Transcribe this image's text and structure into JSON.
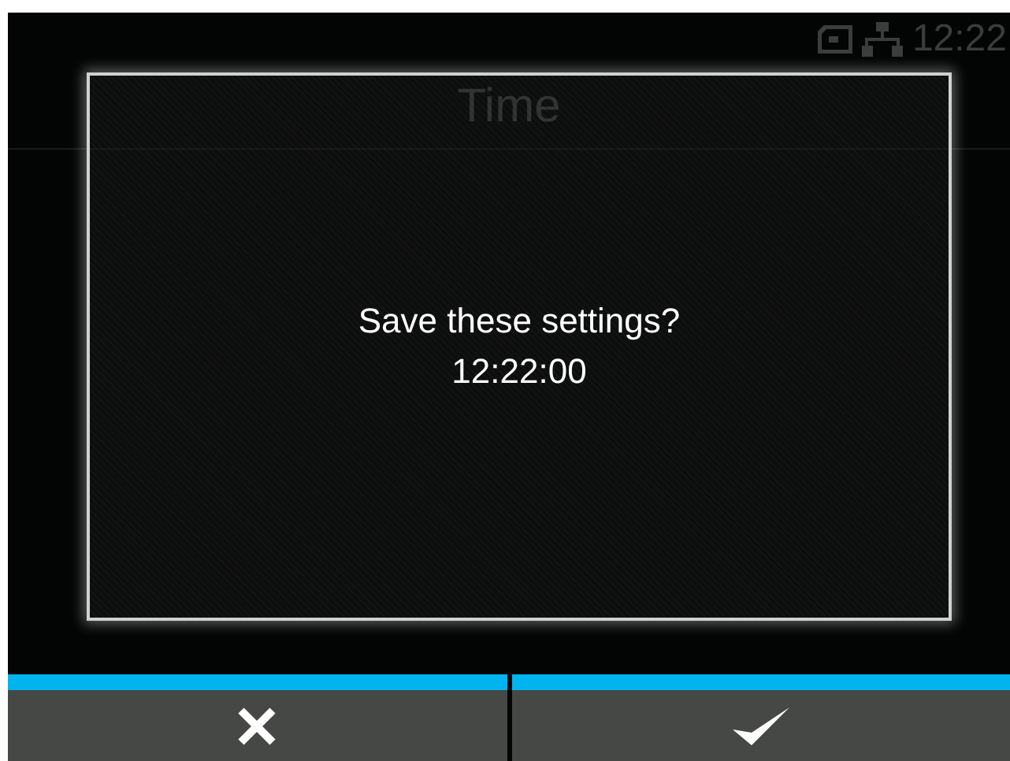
{
  "status_bar": {
    "time": "12:22"
  },
  "screen": {
    "title": "Time"
  },
  "dialog": {
    "message": "Save these settings?",
    "value": "12:22:00"
  },
  "buttons": [
    {
      "kind": "cancel"
    },
    {
      "kind": "confirm"
    }
  ]
}
